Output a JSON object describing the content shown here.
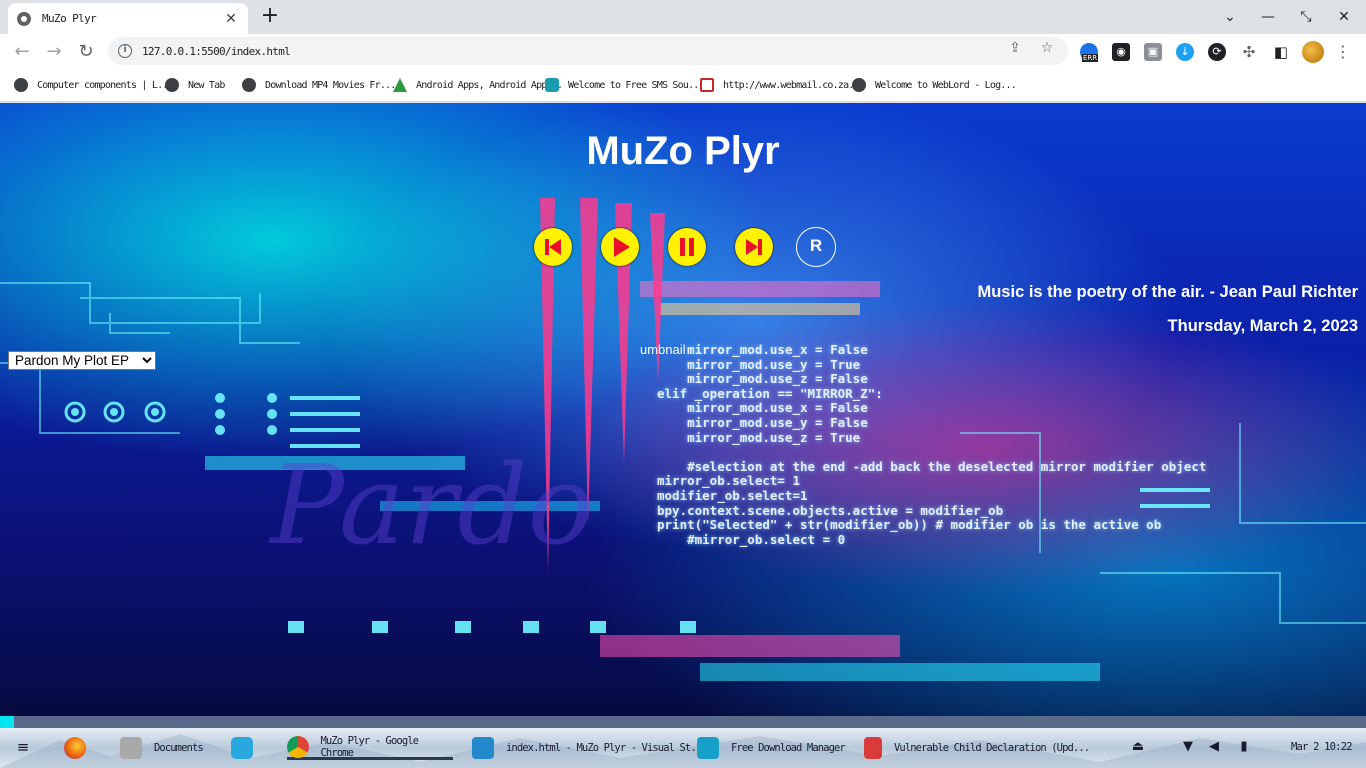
{
  "browser": {
    "tab": {
      "title": "MuZo Plyr",
      "close": "✕"
    },
    "new_tab": "+",
    "window_controls": {
      "list": "⌄",
      "minimize": "—",
      "restore": "⤡",
      "close": "✕"
    },
    "nav": {
      "back": "←",
      "forward": "→",
      "reload": "↻"
    },
    "url": "127.0.0.1:5500/index.html",
    "bookmarks": [
      {
        "label": "Computer components | L...",
        "icon": "globe-icon"
      },
      {
        "label": "New Tab",
        "icon": "globe-icon"
      },
      {
        "label": "Download MP4 Movies Fr...",
        "icon": "globe-icon"
      },
      {
        "label": "Android Apps, Android App...",
        "icon": "android-icon"
      },
      {
        "label": "Welcome to Free SMS Sou...",
        "icon": "sms-icon"
      },
      {
        "label": "http://www.webmail.co.za...",
        "icon": "mail-icon"
      },
      {
        "label": "Welcome to WebLord - Log...",
        "icon": "globe-icon"
      }
    ],
    "extension_badge": "ERR"
  },
  "page": {
    "title": "MuZo Plyr",
    "controls": {
      "previous": "previous-track-icon",
      "play": "play-icon",
      "pause": "pause-icon",
      "next": "next-track-icon",
      "repeat_label": "R"
    },
    "quote": "Music is the poetry of the air. - Jean Paul Richter",
    "date": "Thursday, March 2, 2023",
    "album_select": {
      "selected": "Pardon My Plot EP"
    },
    "thumbnail_alt": "umbnail",
    "progress": 0.01,
    "colors": {
      "accent": "#fff200",
      "title": "#ffffff",
      "progress": "#00e5f0"
    }
  },
  "taskbar": {
    "items": [
      {
        "label": "Documents"
      },
      {
        "label": "MuZo Plyr - Google Chrome"
      },
      {
        "label": "index.html - MuZo Plyr - Visual St..."
      },
      {
        "label": "Free Download Manager"
      },
      {
        "label": "Vulnerable Child Declaration (Upd..."
      }
    ],
    "clock": "Mar 2  10:22"
  }
}
